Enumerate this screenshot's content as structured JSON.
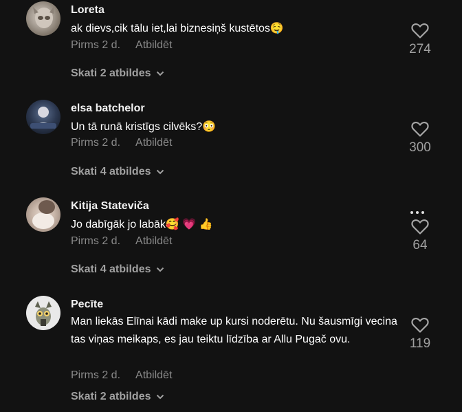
{
  "comments": [
    {
      "author": "Loreta",
      "text": "ak dievs,cik tālu iet,lai biznesiņš kustētos🤤",
      "time": "Pirms 2 d.",
      "reply_label": "Atbildēt",
      "likes": "274",
      "replies_label": "Skati 2 atbildes"
    },
    {
      "author": "elsa batchelor",
      "text": "Un tā runā kristīgs cilvēks?😳",
      "time": "Pirms 2 d.",
      "reply_label": "Atbildēt",
      "likes": "300",
      "replies_label": "Skati 4 atbildes"
    },
    {
      "author": "Kitija Stateviča",
      "text": "Jo dabīgāk jo labāk🥰 💗 👍",
      "time": "Pirms 2 d.",
      "reply_label": "Atbildēt",
      "likes": "64",
      "replies_label": "Skati 4 atbildes"
    },
    {
      "author": "Pecīte",
      "text": "Man liekās Elīnai kādi make up kursi noderētu. Nu šausmīgi vecina tas viņas meikaps, es jau teiktu līdzība ar Allu Pugač ovu.",
      "time": "Pirms 2 d.",
      "reply_label": "Atbildēt",
      "likes": "119",
      "replies_label": "Skati 2 atbildes"
    }
  ],
  "icons": {
    "like": "heart-outline-icon",
    "more": "three-dots-icon",
    "chevron": "chevron-down-icon"
  }
}
